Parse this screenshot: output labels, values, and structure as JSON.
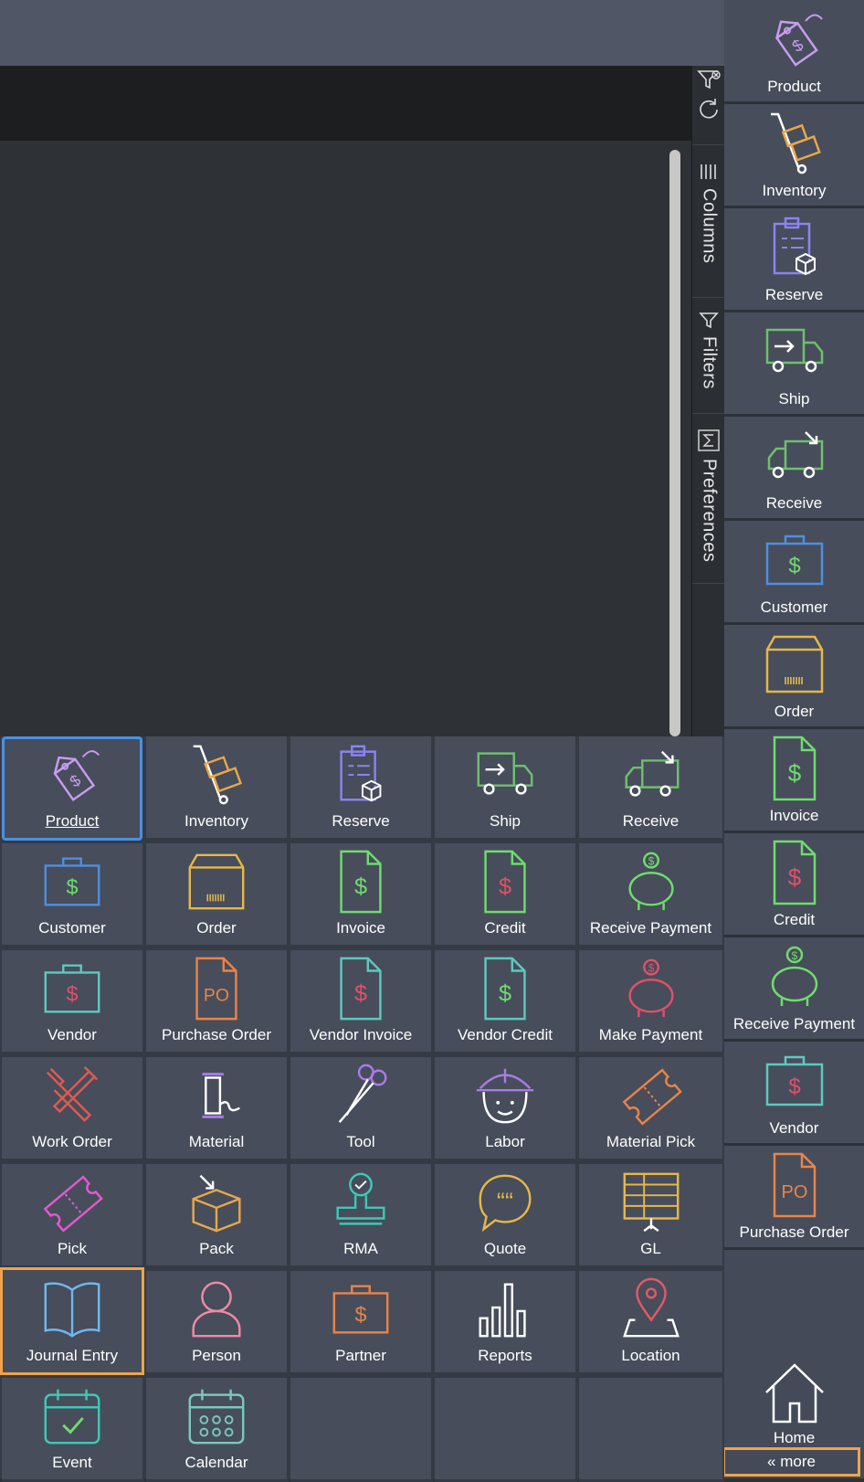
{
  "side_panel": {
    "tabs": [
      {
        "label": "Columns",
        "icon": "columns-icon"
      },
      {
        "label": "Filters",
        "icon": "filter-icon"
      },
      {
        "label": "Preferences",
        "icon": "sigma-icon"
      }
    ],
    "tools": [
      {
        "icon": "clear-filter-icon"
      },
      {
        "icon": "refresh-icon"
      }
    ]
  },
  "sidebar": {
    "items": [
      {
        "label": "Product",
        "icon": "price-tag-icon"
      },
      {
        "label": "Inventory",
        "icon": "hand-truck-icon"
      },
      {
        "label": "Reserve",
        "icon": "clipboard-box-icon"
      },
      {
        "label": "Ship",
        "icon": "truck-out-icon"
      },
      {
        "label": "Receive",
        "icon": "truck-in-icon"
      },
      {
        "label": "Customer",
        "icon": "briefcase-dollar-icon"
      },
      {
        "label": "Order",
        "icon": "box-icon"
      },
      {
        "label": "Invoice",
        "icon": "invoice-icon"
      },
      {
        "label": "Credit",
        "icon": "credit-icon"
      },
      {
        "label": "Receive Payment",
        "icon": "piggy-bank-icon"
      },
      {
        "label": "Vendor",
        "icon": "vendor-briefcase-icon"
      },
      {
        "label": "Purchase Order",
        "icon": "po-document-icon"
      }
    ],
    "home_label": "Home",
    "more_label": "« more"
  },
  "menu": {
    "tiles": [
      {
        "label": "Product",
        "icon": "price-tag-icon"
      },
      {
        "label": "Inventory",
        "icon": "hand-truck-icon"
      },
      {
        "label": "Reserve",
        "icon": "clipboard-box-icon"
      },
      {
        "label": "Ship",
        "icon": "truck-out-icon"
      },
      {
        "label": "Receive",
        "icon": "truck-in-icon"
      },
      {
        "label": "Customer",
        "icon": "briefcase-dollar-icon"
      },
      {
        "label": "Order",
        "icon": "box-icon"
      },
      {
        "label": "Invoice",
        "icon": "invoice-icon"
      },
      {
        "label": "Credit",
        "icon": "credit-icon"
      },
      {
        "label": "Receive Payment",
        "icon": "piggy-bank-icon"
      },
      {
        "label": "Vendor",
        "icon": "vendor-briefcase-icon"
      },
      {
        "label": "Purchase Order",
        "icon": "po-document-icon"
      },
      {
        "label": "Vendor Invoice",
        "icon": "vendor-invoice-icon"
      },
      {
        "label": "Vendor Credit",
        "icon": "vendor-credit-icon"
      },
      {
        "label": "Make Payment",
        "icon": "piggy-bank-red-icon"
      },
      {
        "label": "Work Order",
        "icon": "wrench-hammer-icon"
      },
      {
        "label": "Material",
        "icon": "spool-icon"
      },
      {
        "label": "Tool",
        "icon": "scissors-icon"
      },
      {
        "label": "Labor",
        "icon": "hard-hat-worker-icon"
      },
      {
        "label": "Material Pick",
        "icon": "ticket-icon"
      },
      {
        "label": "Pick",
        "icon": "pick-ticket-icon"
      },
      {
        "label": "Pack",
        "icon": "open-box-icon"
      },
      {
        "label": "RMA",
        "icon": "stamp-icon"
      },
      {
        "label": "Quote",
        "icon": "quote-bubble-icon"
      },
      {
        "label": "GL",
        "icon": "ledger-board-icon"
      },
      {
        "label": "Journal Entry",
        "icon": "book-icon"
      },
      {
        "label": "Person",
        "icon": "person-icon"
      },
      {
        "label": "Partner",
        "icon": "partner-briefcase-icon"
      },
      {
        "label": "Reports",
        "icon": "bar-chart-icon"
      },
      {
        "label": "Location",
        "icon": "map-pin-icon"
      },
      {
        "label": "Event",
        "icon": "calendar-check-icon"
      },
      {
        "label": "Calendar",
        "icon": "calendar-icon"
      }
    ]
  },
  "colors": {
    "accent_selected": "#4a90e2",
    "accent_highlight": "#f0a44a",
    "tile_bg": "#474d5a"
  }
}
